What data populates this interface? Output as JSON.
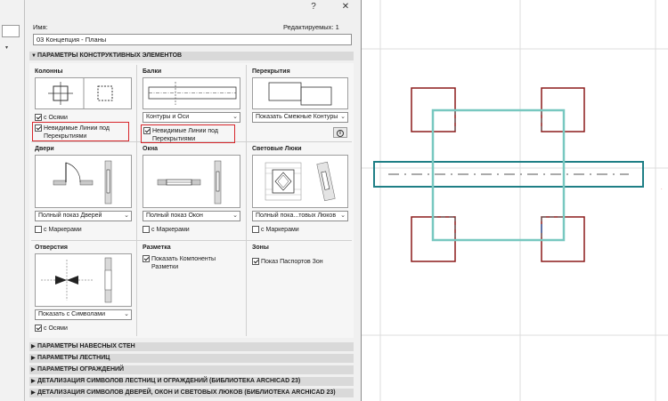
{
  "dialog": {
    "title_help": "?",
    "title_close": "✕",
    "name_label": "Имя:",
    "editable": "Редактируемых: 1",
    "name_value": "03 Концепция - Планы"
  },
  "sections": {
    "structural": "ПАРАМЕТРЫ КОНСТРУКТИВНЫХ ЭЛЕМЕНТОВ",
    "collapsed": [
      "ПАРАМЕТРЫ НАВЕСНЫХ СТЕН",
      "ПАРАМЕТРЫ ЛЕСТНИЦ",
      "ПАРАМЕТРЫ ОГРАЖДЕНИЙ",
      "ДЕТАЛИЗАЦИЯ СИМВОЛОВ ЛЕСТНИЦ И ОГРАЖДЕНИЙ (БИБЛИОТЕКА ARCHICAD 23)",
      "ДЕТАЛИЗАЦИЯ СИМВОЛОВ ДВЕРЕЙ, ОКОН И СВЕТОВЫХ ЛЮКОВ (БИБЛИОТЕКА ARCHICAD 23)"
    ]
  },
  "columns": {
    "label": "Колонны",
    "with_axes": "с Осями",
    "hidden_lines": "Невидимые Линии под Перекрытиями"
  },
  "beams": {
    "label": "Балки",
    "select": "Контуры и Оси",
    "hidden_lines": "Невидимые Линии под Перекрытиями"
  },
  "slabs": {
    "label": "Перекрытия",
    "select": "Показать Смежные Контуры"
  },
  "doors": {
    "label": "Двери",
    "select": "Полный показ Дверей",
    "markers": "с Маркерами"
  },
  "windows": {
    "label": "Окна",
    "select": "Полный показ Окон",
    "markers": "с Маркерами"
  },
  "skylights": {
    "label": "Световые Люки",
    "select": "Полный пока...товых Люков",
    "markers": "с Маркерами"
  },
  "openings": {
    "label": "Отверстия",
    "select": "Показать с Символами",
    "with_axes": "с Осями"
  },
  "markup": {
    "label": "Разметка",
    "show_components": "Показать Компоненты Разметки"
  },
  "zones": {
    "label": "Зоны",
    "show_stamps": "Показ Паспортов Зон"
  },
  "colors": {
    "red_highlight": "#d7262b",
    "column_red": "#8b1a1a",
    "slab_teal": "#78c8c0",
    "beam_teal": "#1f7f86",
    "grid": "#dcdcdc"
  }
}
